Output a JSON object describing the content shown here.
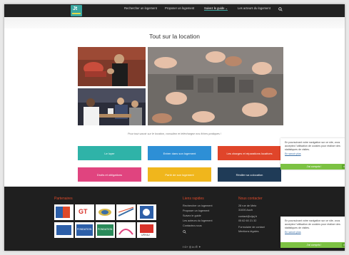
{
  "header": {
    "logo_text": "Jt",
    "nav": [
      {
        "label": "Rechercher un logement"
      },
      {
        "label": "Proposer un logement"
      },
      {
        "label": "Suivez le guide ⌄"
      },
      {
        "label": "Les acteurs du logement"
      }
    ]
  },
  "main": {
    "title": "Tout sur la location",
    "caption": "Pour tout savoir sur le location, consultez et téléchargez nos fiches pratiques !"
  },
  "tiles": [
    {
      "label": "Le loyer",
      "color": "#2fb3a8"
    },
    {
      "label": "Entrer dans son logement",
      "color": "#2d8fd6"
    },
    {
      "label": "Les charges et réparations locatives",
      "color": "#e0452a"
    },
    {
      "label": "Droits et obligations",
      "color": "#e0447f"
    },
    {
      "label": "Partir de son logement",
      "color": "#f0b61c"
    },
    {
      "label": "Résilier sa colocation",
      "color": "#1f3b57"
    }
  ],
  "cookie": {
    "text": "En poursuivant votre navigation sur ce site, vous acceptez l'utilisation de cookies pour réaliser des statistiques de visites.",
    "link": "En savoir plus",
    "button": "J'ai compris !",
    "close": "×"
  },
  "footer": {
    "partners_heading": "Partenaires",
    "links_heading": "Liens rapides",
    "links": [
      "Rechercher un logement",
      "Proposer un logement",
      "Suivez le guide",
      "Les acteurs du logement",
      "Contactez-nous"
    ],
    "contact_heading": "Nous contacter",
    "contact": [
      "28 rue de Metz",
      "31000 Auch",
      "contact@cijaj.fr",
      "05 62 60 21 32",
      "Formulaire de contact",
      "Mentions légales"
    ],
    "partner_labels": [
      "GT",
      "FONDATION",
      "FONDATION",
      "URHAJ"
    ],
    "social": "f  G+  ◎  in  ✆  ✦"
  }
}
